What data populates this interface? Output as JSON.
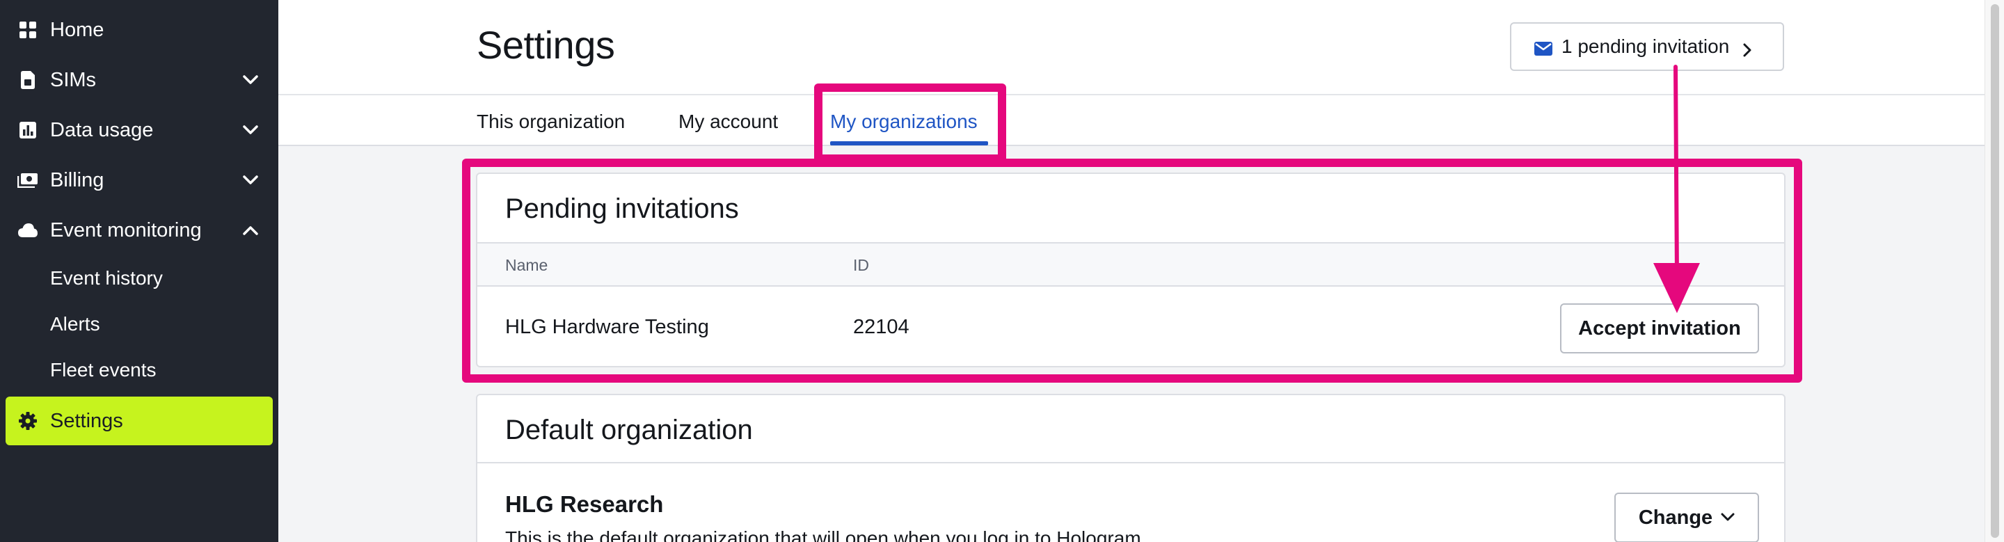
{
  "sidebar": {
    "items": [
      {
        "label": "Home",
        "icon": "grid-icon"
      },
      {
        "label": "SIMs",
        "icon": "sim-card-icon"
      },
      {
        "label": "Data usage",
        "icon": "bar-chart-icon"
      },
      {
        "label": "Billing",
        "icon": "money-icon"
      },
      {
        "label": "Event monitoring",
        "icon": "cloud-icon"
      }
    ],
    "sub_items": [
      "Event history",
      "Alerts",
      "Fleet events"
    ],
    "settings_label": "Settings"
  },
  "header": {
    "title": "Settings",
    "pending_invitation_label": "1 pending invitation",
    "tabs": [
      "This organization",
      "My account",
      "My organizations"
    ],
    "active_tab": "My organizations"
  },
  "pending_invitations": {
    "title": "Pending invitations",
    "columns": [
      "Name",
      "ID"
    ],
    "rows": [
      {
        "name": "HLG Hardware Testing",
        "id": "22104",
        "action": "Accept invitation"
      }
    ]
  },
  "default_organization": {
    "title": "Default organization",
    "org_name": "HLG Research",
    "description": "This is the default organization that will open when you log in to Hologram.",
    "change_label": "Change"
  },
  "colors": {
    "sidebar_bg": "#22262f",
    "active_nav": "#c6f31e",
    "accent_blue": "#1f55c4",
    "annotation_pink": "#e5087d"
  }
}
